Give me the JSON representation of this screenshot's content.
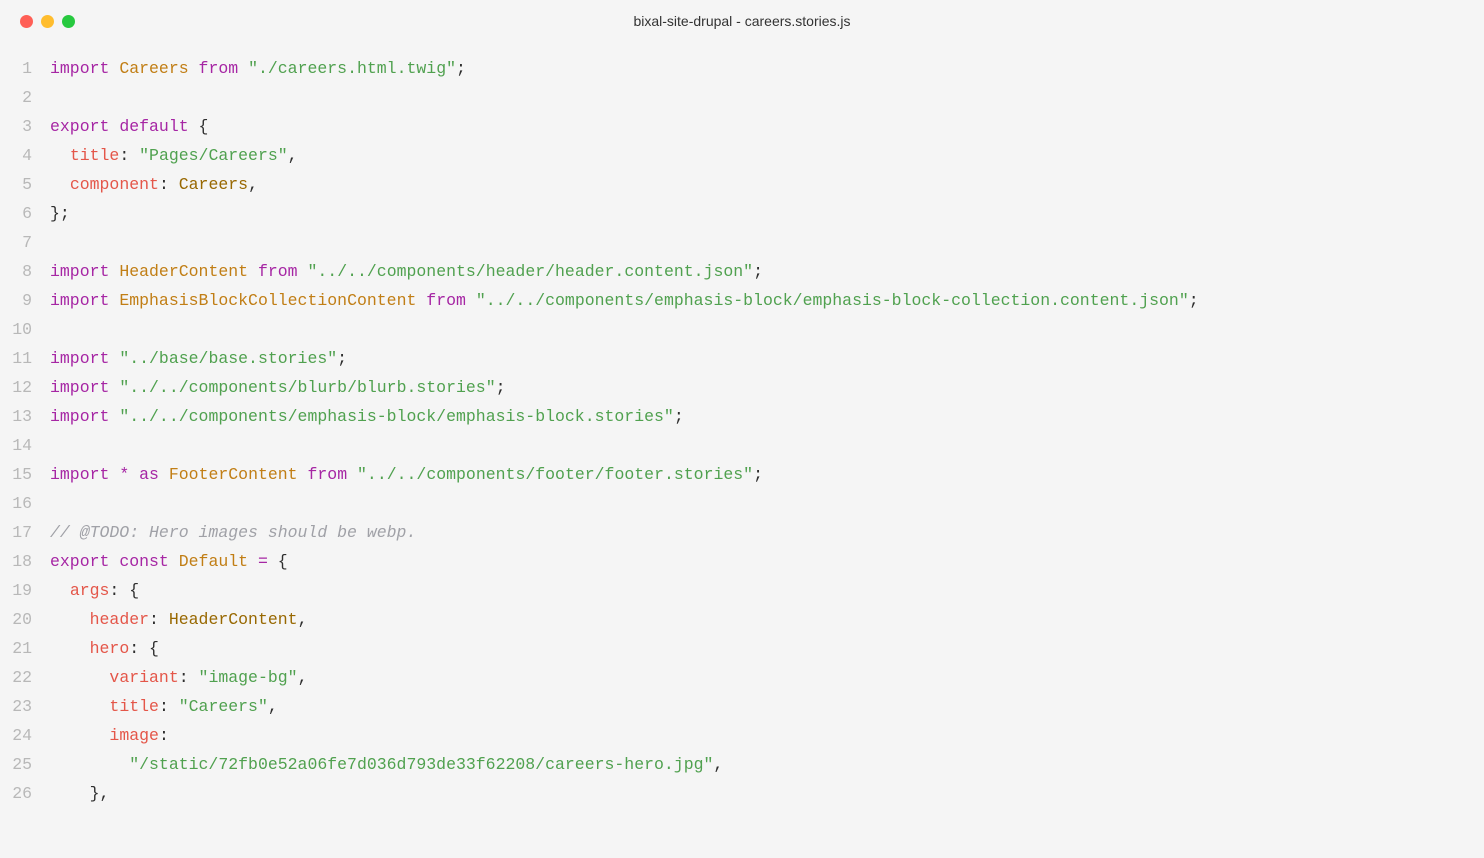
{
  "window": {
    "title": "bixal-site-drupal - careers.stories.js"
  },
  "code": {
    "lines": [
      {
        "num": "1",
        "tokens": [
          {
            "cls": "kw",
            "t": "import"
          },
          {
            "cls": "txt",
            "t": " "
          },
          {
            "cls": "def",
            "t": "Careers"
          },
          {
            "cls": "txt",
            "t": " "
          },
          {
            "cls": "kw",
            "t": "from"
          },
          {
            "cls": "txt",
            "t": " "
          },
          {
            "cls": "str",
            "t": "\"./careers.html.twig\""
          },
          {
            "cls": "pun",
            "t": ";"
          }
        ]
      },
      {
        "num": "2",
        "tokens": []
      },
      {
        "num": "3",
        "tokens": [
          {
            "cls": "kw",
            "t": "export"
          },
          {
            "cls": "txt",
            "t": " "
          },
          {
            "cls": "kw",
            "t": "default"
          },
          {
            "cls": "txt",
            "t": " "
          },
          {
            "cls": "pun",
            "t": "{"
          }
        ]
      },
      {
        "num": "4",
        "tokens": [
          {
            "cls": "txt",
            "t": "  "
          },
          {
            "cls": "prop",
            "t": "title"
          },
          {
            "cls": "pun",
            "t": ":"
          },
          {
            "cls": "txt",
            "t": " "
          },
          {
            "cls": "str",
            "t": "\"Pages/Careers\""
          },
          {
            "cls": "pun",
            "t": ","
          }
        ]
      },
      {
        "num": "5",
        "tokens": [
          {
            "cls": "txt",
            "t": "  "
          },
          {
            "cls": "prop",
            "t": "component"
          },
          {
            "cls": "pun",
            "t": ":"
          },
          {
            "cls": "txt",
            "t": " "
          },
          {
            "cls": "ident",
            "t": "Careers"
          },
          {
            "cls": "pun",
            "t": ","
          }
        ]
      },
      {
        "num": "6",
        "tokens": [
          {
            "cls": "pun",
            "t": "};"
          }
        ]
      },
      {
        "num": "7",
        "tokens": []
      },
      {
        "num": "8",
        "tokens": [
          {
            "cls": "kw",
            "t": "import"
          },
          {
            "cls": "txt",
            "t": " "
          },
          {
            "cls": "def",
            "t": "HeaderContent"
          },
          {
            "cls": "txt",
            "t": " "
          },
          {
            "cls": "kw",
            "t": "from"
          },
          {
            "cls": "txt",
            "t": " "
          },
          {
            "cls": "str",
            "t": "\"../../components/header/header.content.json\""
          },
          {
            "cls": "pun",
            "t": ";"
          }
        ]
      },
      {
        "num": "9",
        "tokens": [
          {
            "cls": "kw",
            "t": "import"
          },
          {
            "cls": "txt",
            "t": " "
          },
          {
            "cls": "def",
            "t": "EmphasisBlockCollectionContent"
          },
          {
            "cls": "txt",
            "t": " "
          },
          {
            "cls": "kw",
            "t": "from"
          },
          {
            "cls": "txt",
            "t": " "
          },
          {
            "cls": "str",
            "t": "\"../../components/emphasis-block/emphasis-block-collection.content.json\""
          },
          {
            "cls": "pun",
            "t": ";"
          }
        ]
      },
      {
        "num": "10",
        "tokens": []
      },
      {
        "num": "11",
        "tokens": [
          {
            "cls": "kw",
            "t": "import"
          },
          {
            "cls": "txt",
            "t": " "
          },
          {
            "cls": "str",
            "t": "\"../base/base.stories\""
          },
          {
            "cls": "pun",
            "t": ";"
          }
        ]
      },
      {
        "num": "12",
        "tokens": [
          {
            "cls": "kw",
            "t": "import"
          },
          {
            "cls": "txt",
            "t": " "
          },
          {
            "cls": "str",
            "t": "\"../../components/blurb/blurb.stories\""
          },
          {
            "cls": "pun",
            "t": ";"
          }
        ]
      },
      {
        "num": "13",
        "tokens": [
          {
            "cls": "kw",
            "t": "import"
          },
          {
            "cls": "txt",
            "t": " "
          },
          {
            "cls": "str",
            "t": "\"../../components/emphasis-block/emphasis-block.stories\""
          },
          {
            "cls": "pun",
            "t": ";"
          }
        ]
      },
      {
        "num": "14",
        "tokens": []
      },
      {
        "num": "15",
        "tokens": [
          {
            "cls": "kw",
            "t": "import"
          },
          {
            "cls": "txt",
            "t": " "
          },
          {
            "cls": "op",
            "t": "*"
          },
          {
            "cls": "txt",
            "t": " "
          },
          {
            "cls": "kw",
            "t": "as"
          },
          {
            "cls": "txt",
            "t": " "
          },
          {
            "cls": "def",
            "t": "FooterContent"
          },
          {
            "cls": "txt",
            "t": " "
          },
          {
            "cls": "kw",
            "t": "from"
          },
          {
            "cls": "txt",
            "t": " "
          },
          {
            "cls": "str",
            "t": "\"../../components/footer/footer.stories\""
          },
          {
            "cls": "pun",
            "t": ";"
          }
        ]
      },
      {
        "num": "16",
        "tokens": []
      },
      {
        "num": "17",
        "tokens": [
          {
            "cls": "cmt",
            "t": "// @TODO: Hero images should be webp."
          }
        ]
      },
      {
        "num": "18",
        "tokens": [
          {
            "cls": "kw",
            "t": "export"
          },
          {
            "cls": "txt",
            "t": " "
          },
          {
            "cls": "kw",
            "t": "const"
          },
          {
            "cls": "txt",
            "t": " "
          },
          {
            "cls": "def",
            "t": "Default"
          },
          {
            "cls": "txt",
            "t": " "
          },
          {
            "cls": "op",
            "t": "="
          },
          {
            "cls": "txt",
            "t": " "
          },
          {
            "cls": "pun",
            "t": "{"
          }
        ]
      },
      {
        "num": "19",
        "tokens": [
          {
            "cls": "txt",
            "t": "  "
          },
          {
            "cls": "prop",
            "t": "args"
          },
          {
            "cls": "pun",
            "t": ":"
          },
          {
            "cls": "txt",
            "t": " "
          },
          {
            "cls": "pun",
            "t": "{"
          }
        ]
      },
      {
        "num": "20",
        "tokens": [
          {
            "cls": "txt",
            "t": "    "
          },
          {
            "cls": "prop",
            "t": "header"
          },
          {
            "cls": "pun",
            "t": ":"
          },
          {
            "cls": "txt",
            "t": " "
          },
          {
            "cls": "ident",
            "t": "HeaderContent"
          },
          {
            "cls": "pun",
            "t": ","
          }
        ]
      },
      {
        "num": "21",
        "tokens": [
          {
            "cls": "txt",
            "t": "    "
          },
          {
            "cls": "prop",
            "t": "hero"
          },
          {
            "cls": "pun",
            "t": ":"
          },
          {
            "cls": "txt",
            "t": " "
          },
          {
            "cls": "pun",
            "t": "{"
          }
        ]
      },
      {
        "num": "22",
        "tokens": [
          {
            "cls": "txt",
            "t": "      "
          },
          {
            "cls": "prop",
            "t": "variant"
          },
          {
            "cls": "pun",
            "t": ":"
          },
          {
            "cls": "txt",
            "t": " "
          },
          {
            "cls": "str",
            "t": "\"image-bg\""
          },
          {
            "cls": "pun",
            "t": ","
          }
        ]
      },
      {
        "num": "23",
        "tokens": [
          {
            "cls": "txt",
            "t": "      "
          },
          {
            "cls": "prop",
            "t": "title"
          },
          {
            "cls": "pun",
            "t": ":"
          },
          {
            "cls": "txt",
            "t": " "
          },
          {
            "cls": "str",
            "t": "\"Careers\""
          },
          {
            "cls": "pun",
            "t": ","
          }
        ]
      },
      {
        "num": "24",
        "tokens": [
          {
            "cls": "txt",
            "t": "      "
          },
          {
            "cls": "prop",
            "t": "image"
          },
          {
            "cls": "pun",
            "t": ":"
          }
        ]
      },
      {
        "num": "25",
        "tokens": [
          {
            "cls": "txt",
            "t": "        "
          },
          {
            "cls": "str",
            "t": "\"/static/72fb0e52a06fe7d036d793de33f62208/careers-hero.jpg\""
          },
          {
            "cls": "pun",
            "t": ","
          }
        ]
      },
      {
        "num": "26",
        "tokens": [
          {
            "cls": "txt",
            "t": "    "
          },
          {
            "cls": "pun",
            "t": "},"
          }
        ]
      }
    ]
  }
}
